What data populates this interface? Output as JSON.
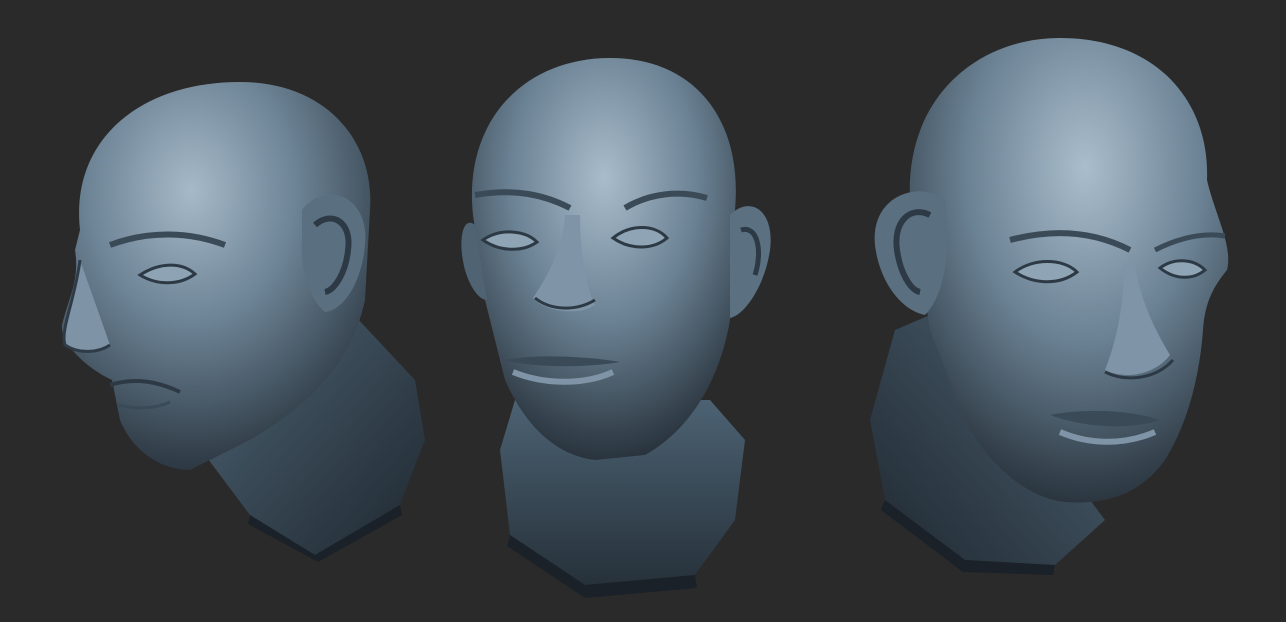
{
  "scene": {
    "background_color": "#2a2a2a",
    "material_base_color": "#5f7688",
    "material_highlight_color": "#a9bccb",
    "material_shadow_color": "#222c35",
    "views": [
      {
        "id": "left-three-quarter",
        "facing": "left"
      },
      {
        "id": "front",
        "facing": "front"
      },
      {
        "id": "right-three-quarter",
        "facing": "right"
      }
    ]
  }
}
